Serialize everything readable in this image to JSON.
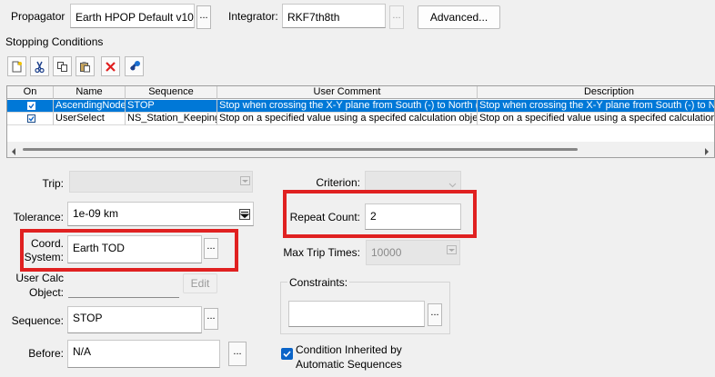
{
  "top": {
    "propagator_label": "Propagator",
    "propagator_value": "Earth HPOP Default v10",
    "integrator_label": "Integrator:",
    "integrator_value": "RKF7th8th",
    "advanced_label": "Advanced...",
    "dots": "..."
  },
  "stopping": {
    "title": "Stopping Conditions",
    "toolbar": [
      "new-icon",
      "cut-icon",
      "copy-icon",
      "paste-icon",
      "delete-icon",
      "properties-icon"
    ],
    "columns": [
      "On",
      "Name",
      "Sequence",
      "User Comment",
      "Description"
    ],
    "rows": [
      {
        "on": true,
        "name": "AscendingNode",
        "sequence": "STOP",
        "comment": "Stop when crossing the X-Y plane from South (-) to North (+)",
        "description": "Stop when crossing the X-Y plane from South (-) to North",
        "selected": true
      },
      {
        "on": true,
        "name": "UserSelect",
        "sequence": "NS_Station_Keeping",
        "comment": "Stop on a specified value using a specifed calculation object",
        "description": "Stop on a specified value using a specifed calculation ob",
        "selected": false
      }
    ]
  },
  "form": {
    "trip_label": "Trip:",
    "trip_value": "",
    "tolerance_label": "Tolerance:",
    "tolerance_value": "1e-09 km",
    "coord_label_1": "Coord.",
    "coord_label_2": "System:",
    "coord_value": "Earth TOD",
    "usercalc_label_1": "User Calc",
    "usercalc_label_2": "Object:",
    "usercalc_value": "",
    "edit_label": "Edit",
    "sequence_label": "Sequence:",
    "sequence_value": "STOP",
    "before_label": "Before:",
    "before_value": "N/A",
    "criterion_label": "Criterion:",
    "criterion_value": "",
    "repeat_label": "Repeat Count:",
    "repeat_value": "2",
    "maxtrip_label": "Max Trip Times:",
    "maxtrip_value": "10000",
    "constraints_label": "Constraints:",
    "constraints_value": "",
    "inherited_line1": "Condition Inherited by",
    "inherited_line2": "Automatic Sequences",
    "inherited_checked": true
  },
  "colors": {
    "selection": "#0078d7",
    "highlight_box": "#e02121",
    "checkbox": "#0a64c8"
  }
}
